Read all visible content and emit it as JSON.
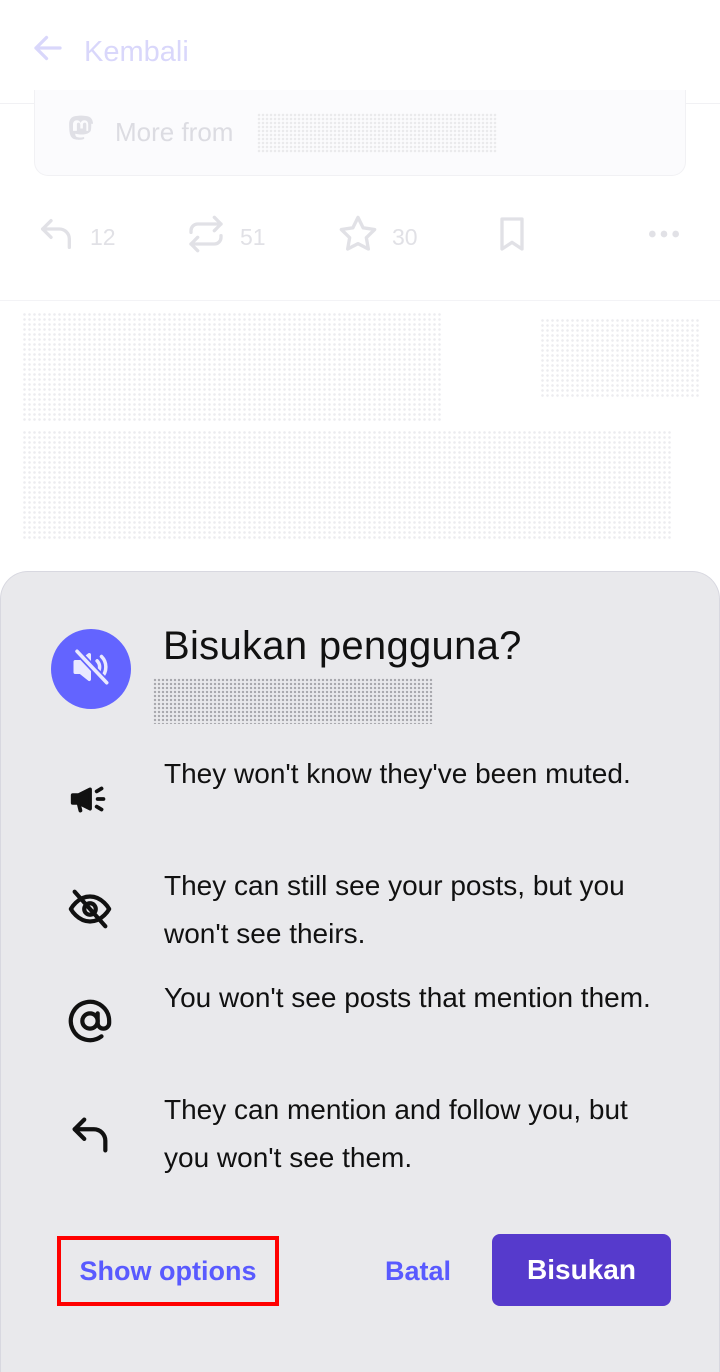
{
  "background_page": {
    "back_label": "Kembali",
    "more_from_label": "More from",
    "actions": {
      "reply_count": "12",
      "boost_count": "51",
      "favourite_count": "30"
    }
  },
  "dialog": {
    "title": "Bisukan pengguna?",
    "items": [
      {
        "icon": "megaphone-icon",
        "text": "They won't know they've been muted."
      },
      {
        "icon": "eye-off-icon",
        "text": "They can still see your posts, but you won't see theirs."
      },
      {
        "icon": "at-sign-icon",
        "text": "You won't see posts that mention them."
      },
      {
        "icon": "reply-icon",
        "text": "They can mention and follow you, but you won't see them."
      }
    ],
    "buttons": {
      "show_options": "Show options",
      "cancel": "Batal",
      "confirm": "Bisukan"
    }
  },
  "colors": {
    "accent": "#6364ff",
    "primary_button": "#563acc",
    "highlight_border": "#ff0000",
    "sheet_background": "#e9e9ec"
  }
}
